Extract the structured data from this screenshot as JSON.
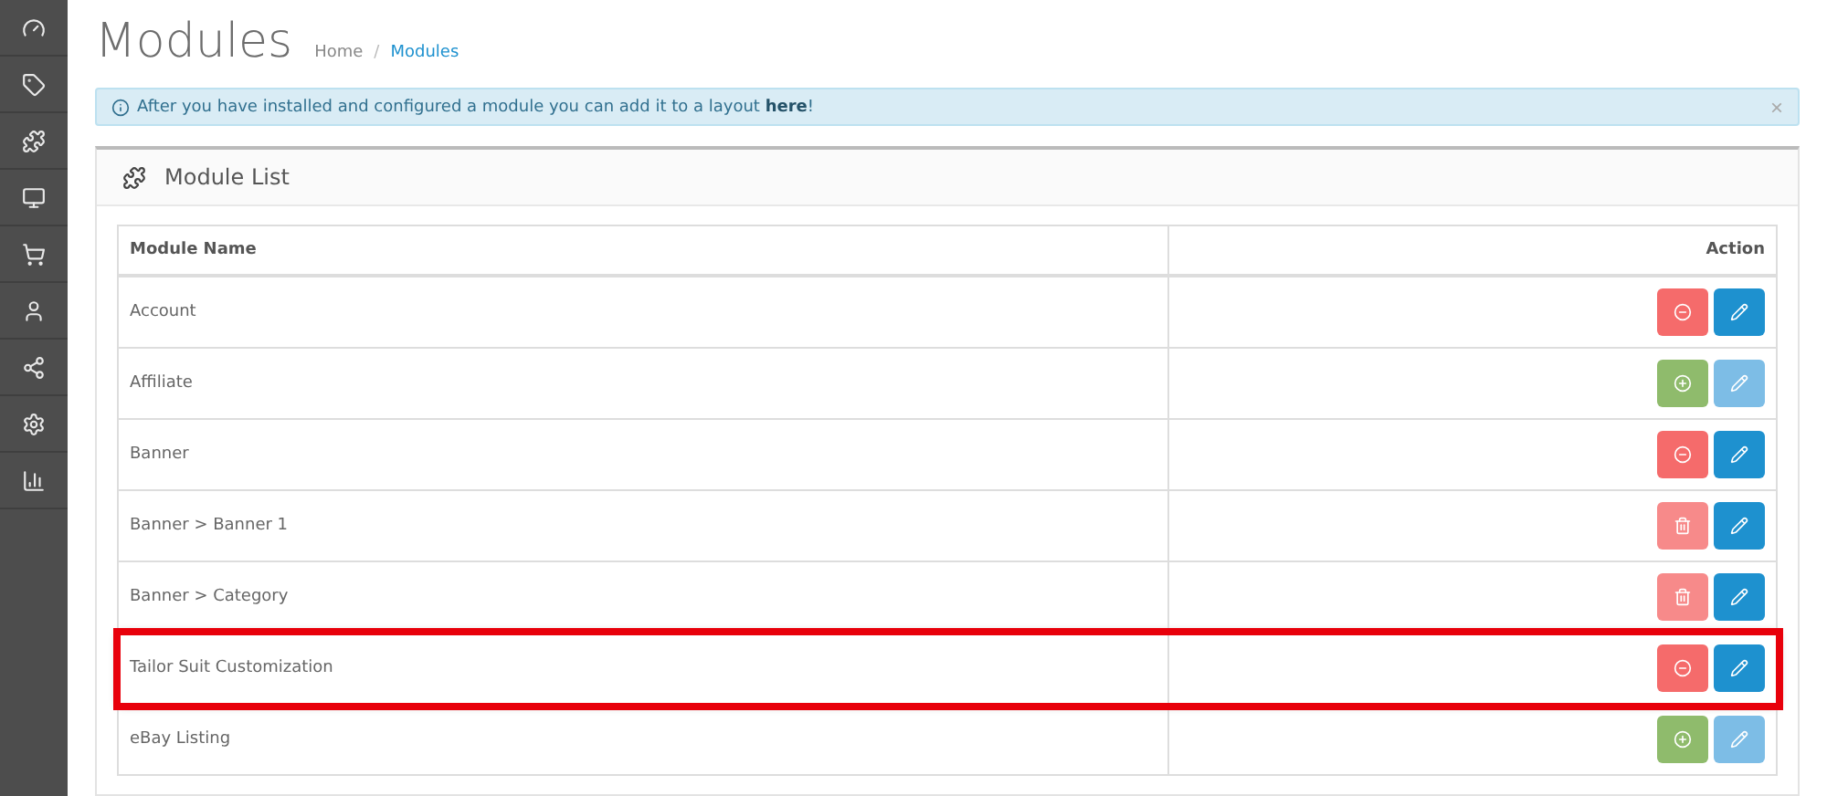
{
  "page": {
    "title": "Modules",
    "breadcrumb_separator": "/",
    "breadcrumb": [
      {
        "label": "Home",
        "selected": false
      },
      {
        "label": "Modules",
        "selected": true
      }
    ]
  },
  "alert": {
    "text": "After you have installed and configured a module you can add it to a layout ",
    "link": "here",
    "text_end": "!",
    "close": "×"
  },
  "panel": {
    "title": "Module List"
  },
  "table": {
    "columns": [
      "Module Name",
      "Action"
    ],
    "rows": [
      {
        "name": "Account",
        "kind": "uninstall",
        "edit_disabled": false,
        "highlighted": false
      },
      {
        "name": "Affiliate",
        "kind": "install",
        "edit_disabled": true,
        "highlighted": false
      },
      {
        "name": "Banner",
        "kind": "uninstall",
        "edit_disabled": false,
        "highlighted": false
      },
      {
        "name": "Banner > Banner 1",
        "kind": "delete",
        "edit_disabled": false,
        "highlighted": false
      },
      {
        "name": "Banner > Category",
        "kind": "delete",
        "edit_disabled": false,
        "highlighted": false
      },
      {
        "name": "Tailor Suit Customization",
        "kind": "uninstall",
        "edit_disabled": false,
        "highlighted": true
      },
      {
        "name": "eBay Listing",
        "kind": "install",
        "edit_disabled": true,
        "highlighted": false
      }
    ]
  }
}
